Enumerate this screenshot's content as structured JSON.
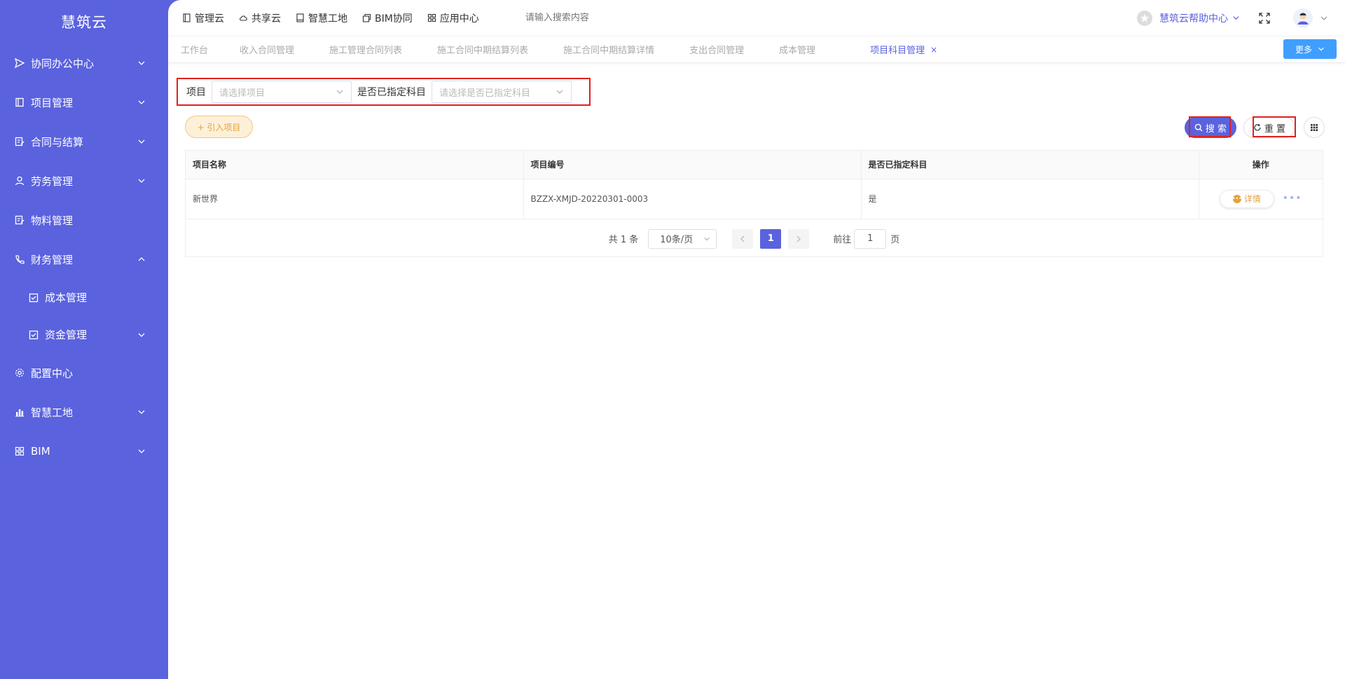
{
  "sidebar": {
    "logo": "慧筑云",
    "items": [
      {
        "label": "协同办公中心",
        "icon": "send-icon",
        "expandable": true,
        "expanded": false
      },
      {
        "label": "项目管理",
        "icon": "book-icon",
        "expandable": true,
        "expanded": false
      },
      {
        "label": "合同与结算",
        "icon": "edit-icon",
        "expandable": true,
        "expanded": false
      },
      {
        "label": "劳务管理",
        "icon": "user-icon",
        "expandable": true,
        "expanded": false
      },
      {
        "label": "物料管理",
        "icon": "edit-icon",
        "expandable": false
      },
      {
        "label": "财务管理",
        "icon": "phone-icon",
        "expandable": true,
        "expanded": true
      },
      {
        "label": "成本管理",
        "icon": "checkbox-icon",
        "expandable": false,
        "sub": true
      },
      {
        "label": "资金管理",
        "icon": "checkbox-icon",
        "expandable": true,
        "sub": true
      },
      {
        "label": "配置中心",
        "icon": "gear-icon",
        "expandable": false
      },
      {
        "label": "智慧工地",
        "icon": "bar-chart-icon",
        "expandable": true
      },
      {
        "label": "BIM",
        "icon": "grid-icon",
        "expandable": true
      }
    ]
  },
  "topbar": {
    "links": [
      {
        "label": "管理云",
        "icon": "doc-icon"
      },
      {
        "label": "共享云",
        "icon": "cloud-icon"
      },
      {
        "label": "智慧工地",
        "icon": "book-icon"
      },
      {
        "label": "BIM协同",
        "icon": "box-icon"
      },
      {
        "label": "应用中心",
        "icon": "apps-icon"
      }
    ],
    "search_placeholder": "请输入搜索内容",
    "help_label": "慧筑云帮助中心"
  },
  "tabs": {
    "items": [
      {
        "label": "工作台",
        "active": false
      },
      {
        "label": "收入合同管理",
        "active": false
      },
      {
        "label": "施工管理合同列表",
        "active": false
      },
      {
        "label": "施工合同中期结算列表",
        "active": false
      },
      {
        "label": "施工合同中期结算详情",
        "active": false
      },
      {
        "label": "支出合同管理",
        "active": false
      },
      {
        "label": "成本管理",
        "active": false
      },
      {
        "label": "项目科目管理",
        "active": true
      }
    ],
    "close_glyph": "×",
    "more_label": "更多"
  },
  "filters": {
    "project_label": "项目",
    "project_placeholder": "请选择项目",
    "assigned_label": "是否已指定科目",
    "assigned_placeholder": "请选择是否已指定科目"
  },
  "actions": {
    "import_label": "+ 引入项目",
    "search_label": "搜 索",
    "reset_label": "重 置"
  },
  "table": {
    "columns": [
      "项目名称",
      "项目编号",
      "是否已指定科目",
      "操作"
    ],
    "rows": [
      {
        "name": "新世界",
        "code": "BZZX-XMJD-20220301-0003",
        "assigned": "是",
        "action": "详情"
      }
    ]
  },
  "pagination": {
    "total": "共 1 条",
    "page_size": "10条/页",
    "current_page": "1",
    "goto_label": "前往",
    "goto_value": "1",
    "page_unit": "页"
  },
  "colors": {
    "brand": "#5a62de",
    "warning": "#e6a23c",
    "primary_blue": "#409eff",
    "highlight_red": "#e02020"
  }
}
